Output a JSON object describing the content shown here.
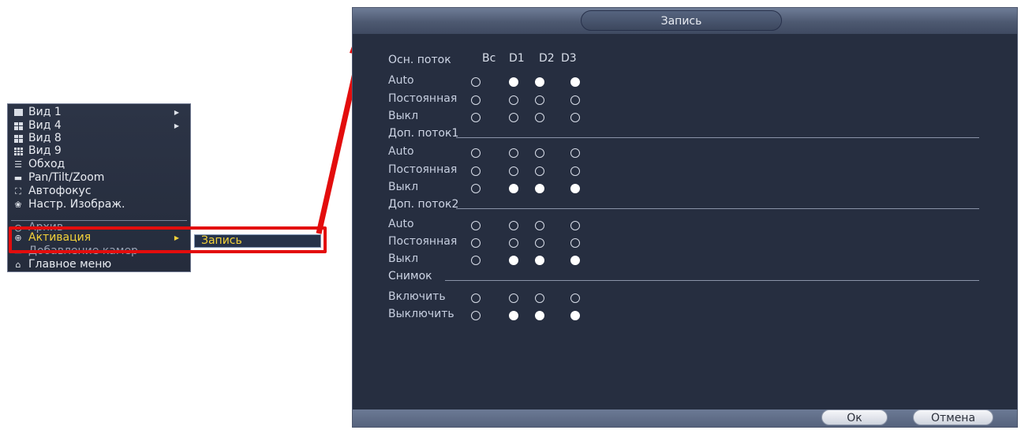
{
  "menu": {
    "items": [
      {
        "label": "Вид 1",
        "icon": "single-view-icon"
      },
      {
        "label": "Вид 4",
        "icon": "quad-view-icon"
      },
      {
        "label": "Вид 8",
        "icon": "eight-view-icon"
      },
      {
        "label": "Вид 9",
        "icon": "nine-view-icon"
      },
      {
        "label": "Обход",
        "icon": "tour-icon"
      },
      {
        "label": "Pan/Tilt/Zoom",
        "icon": "ptz-icon"
      },
      {
        "label": "Автофокус",
        "icon": "autofocus-icon"
      },
      {
        "label": "Настр. Изображ.",
        "icon": "image-settings-icon"
      },
      {
        "label": "Архив",
        "icon": "search-icon"
      },
      {
        "label": "Активация",
        "icon": "activation-icon"
      },
      {
        "label": "Добавление камер",
        "icon": "add-camera-icon"
      },
      {
        "label": "Главное меню",
        "icon": "home-icon"
      }
    ],
    "submenu_item": "Запись"
  },
  "dialog": {
    "title": "Запись",
    "columns": [
      "Вс",
      "D1",
      "D2",
      "D3"
    ],
    "sections": [
      {
        "title": "Осн. поток",
        "rows": [
          {
            "label": "Auto",
            "states": [
              false,
              true,
              true,
              true
            ]
          },
          {
            "label": "Постоянная",
            "states": [
              false,
              false,
              false,
              false
            ]
          },
          {
            "label": "Выкл",
            "states": [
              false,
              false,
              false,
              false
            ]
          }
        ]
      },
      {
        "title": "Доп. поток1",
        "rows": [
          {
            "label": "Auto",
            "states": [
              false,
              false,
              false,
              false
            ]
          },
          {
            "label": "Постоянная",
            "states": [
              false,
              false,
              false,
              false
            ]
          },
          {
            "label": "Выкл",
            "states": [
              false,
              true,
              true,
              true
            ]
          }
        ]
      },
      {
        "title": "Доп. поток2",
        "rows": [
          {
            "label": "Auto",
            "states": [
              false,
              false,
              false,
              false
            ]
          },
          {
            "label": "Постоянная",
            "states": [
              false,
              false,
              false,
              false
            ]
          },
          {
            "label": "Выкл",
            "states": [
              false,
              true,
              true,
              true
            ]
          }
        ]
      },
      {
        "title": "Снимок",
        "rows": [
          {
            "label": "Включить",
            "states": [
              false,
              false,
              false,
              false
            ]
          },
          {
            "label": "Выключить",
            "states": [
              false,
              true,
              true,
              true
            ]
          }
        ]
      }
    ],
    "ok_label": "Ок",
    "cancel_label": "Отмена"
  },
  "colors": {
    "highlight": "#e30d0d",
    "active_text": "#f3d23a",
    "dialog_bg": "#262e40"
  }
}
